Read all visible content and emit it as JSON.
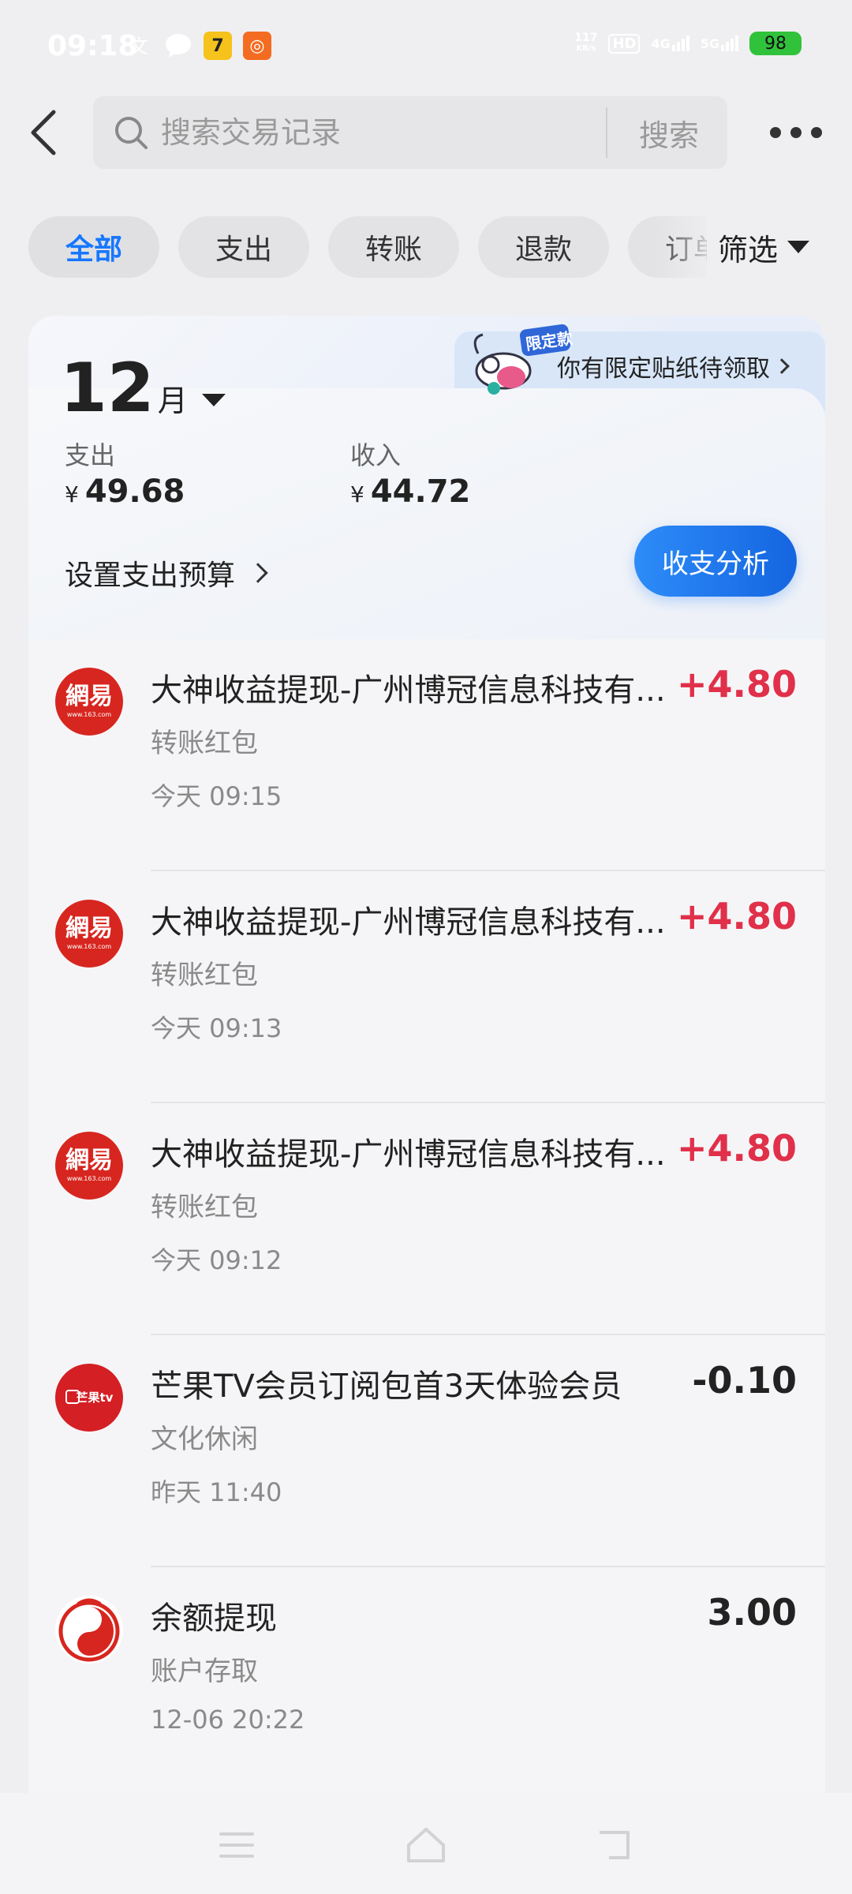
{
  "status_bar": {
    "time": "09:18",
    "net_speed_value": "117",
    "net_speed_unit": "KB/s",
    "signal_4g": "4G",
    "signal_5g": "5G",
    "hd": "HD",
    "battery": "98"
  },
  "header": {
    "search_placeholder": "搜索交易记录",
    "search_button": "搜索"
  },
  "filters": {
    "chips": [
      "全部",
      "支出",
      "转账",
      "退款",
      "订单"
    ],
    "active_index": 0,
    "filter_label": "筛选"
  },
  "summary": {
    "promo_text": "你有限定贴纸待领取",
    "promo_badge": "限定款",
    "month_number": "12",
    "month_unit": "月",
    "expense_label": "支出",
    "expense_currency": "¥",
    "expense_value": "49.68",
    "income_label": "收入",
    "income_currency": "¥",
    "income_value": "44.72",
    "budget_label": "设置支出预算",
    "analysis_button": "收支分析"
  },
  "transactions": [
    {
      "logo": "netease-logo",
      "title": "大神收益提现-广州博冠信息科技有...",
      "category": "转账红包",
      "time": "今天 09:15",
      "amount": "+4.80",
      "positive": true
    },
    {
      "logo": "netease-logo",
      "title": "大神收益提现-广州博冠信息科技有...",
      "category": "转账红包",
      "time": "今天 09:13",
      "amount": "+4.80",
      "positive": true
    },
    {
      "logo": "netease-logo",
      "title": "大神收益提现-广州博冠信息科技有...",
      "category": "转账红包",
      "time": "今天 09:12",
      "amount": "+4.80",
      "positive": true
    },
    {
      "logo": "mangotv-logo",
      "title": "芒果TV会员订阅包首3天体验会员",
      "category": "文化休闲",
      "time": "昨天 11:40",
      "amount": "-0.10",
      "positive": false
    },
    {
      "logo": "balance-logo",
      "title": "余额提现",
      "category": "账户存取",
      "time": "12-06 20:22",
      "amount": "3.00",
      "positive": false
    }
  ],
  "colors": {
    "accent": "#1677ff",
    "income_red": "#e0304a",
    "netease_red": "#d7261f",
    "mango_red": "#d41f24",
    "battery_green": "#31c23b"
  }
}
